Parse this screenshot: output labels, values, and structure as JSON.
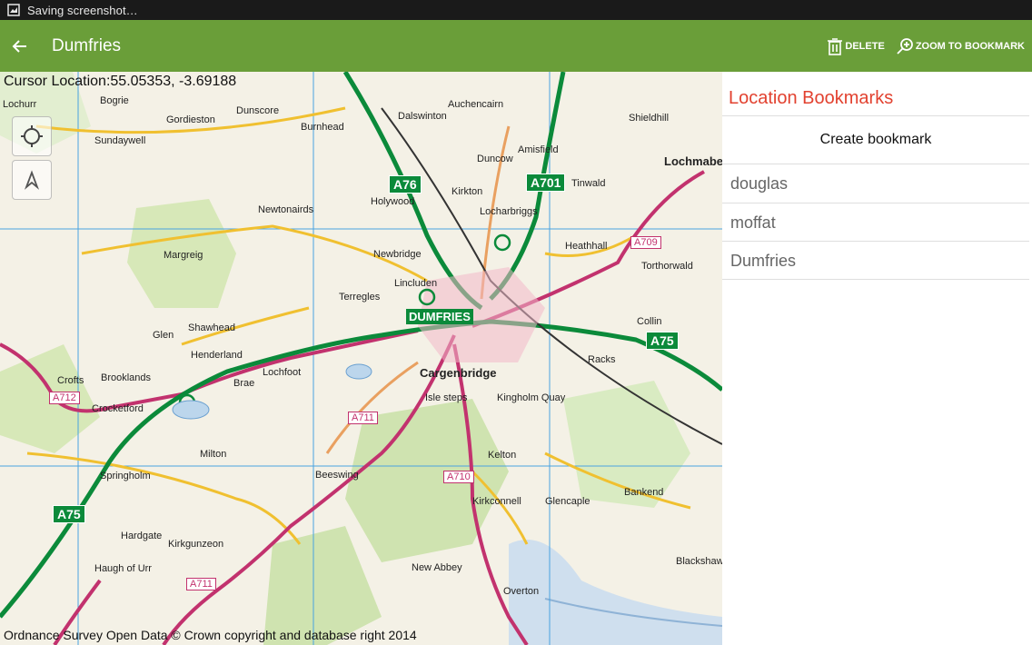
{
  "status_bar": {
    "text": "Saving screenshot…"
  },
  "action_bar": {
    "title": "Dumfries",
    "delete_label": "DELETE",
    "zoom_label": "ZOOM TO BOOKMARK",
    "color": "#6a9e39"
  },
  "map": {
    "cursor_location": "Cursor Location:55.05353, -3.69188",
    "attribution": "Ordnance Survey Open Data © Crown copyright and database right 2014",
    "places": [
      "Locharbriggs",
      "Newbridge",
      "Lincluden",
      "Terregles",
      "Holywood",
      "Newtonairds",
      "Margreig",
      "Shawhead",
      "Glen",
      "Henderland",
      "Lochfoot",
      "Brae",
      "Crocketford",
      "Brooklands",
      "Crofts",
      "Milton",
      "Springholm",
      "Hardgate",
      "Kirkgunzeon",
      "Haugh of Urr",
      "Isle steps",
      "Kingholm Quay",
      "Kelton",
      "Glencaple",
      "Bankend",
      "Racks",
      "Collin",
      "Tinwald",
      "Amisfield",
      "Duncow",
      "Kirkton",
      "Auchencairn",
      "Dalswinton",
      "Dunscore",
      "Burnhead",
      "Gordieston",
      "Bogrie",
      "Sundaywell",
      "Heathhall",
      "Torthorwald",
      "Beeswing",
      "New Abbey",
      "Kirkconnell",
      "Overton",
      "Blackshaw",
      "Lochmabe",
      "Cargenbridge",
      "Shieldhill",
      "Lochurr"
    ],
    "town_label": "DUMFRIES",
    "road_tags": [
      "A76",
      "A701",
      "A75",
      "A75"
    ],
    "pink_tags": [
      "A712",
      "A711",
      "A710",
      "A709",
      "A711"
    ]
  },
  "panel": {
    "title": "Location Bookmarks",
    "create_label": "Create bookmark",
    "bookmarks": [
      "douglas",
      "moffat",
      "Dumfries"
    ],
    "accent": "#e2412f"
  }
}
